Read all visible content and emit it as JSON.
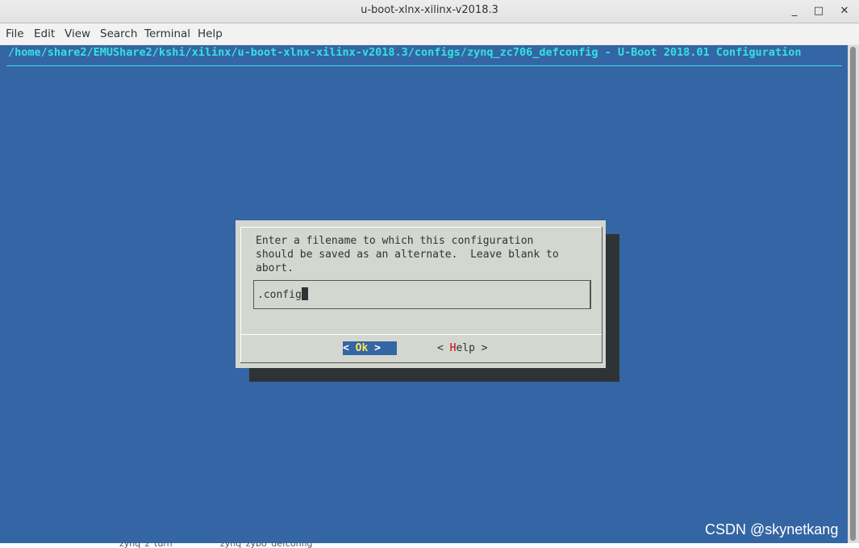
{
  "window": {
    "title": "u-boot-xlnx-xilinx-v2018.3",
    "minimize": "_",
    "maximize": "□",
    "close": "✕"
  },
  "menubar": [
    "File",
    "Edit",
    "View",
    "Search",
    "Terminal",
    "Help"
  ],
  "console": {
    "header": "/home/share2/EMUShare2/kshi/xilinx/u-boot-xlnx-xilinx-v2018.3/configs/zynq_zc706_defconfig - U-Boot 2018.01 Configuration"
  },
  "dialog": {
    "prompt": "Enter a filename to which this configuration\nshould be saved as an alternate.  Leave blank to\nabort.",
    "input_value": ".config",
    "ok": {
      "open": "< ",
      "hot": "Ok",
      "close": " >"
    },
    "help": {
      "open": "< ",
      "hot": "H",
      "rest": "elp",
      "close": " >"
    }
  },
  "watermark": "CSDN @skynetkang",
  "bottom_files": [
    "zynq_z_turn",
    "zynq_zybo_defconfig"
  ]
}
